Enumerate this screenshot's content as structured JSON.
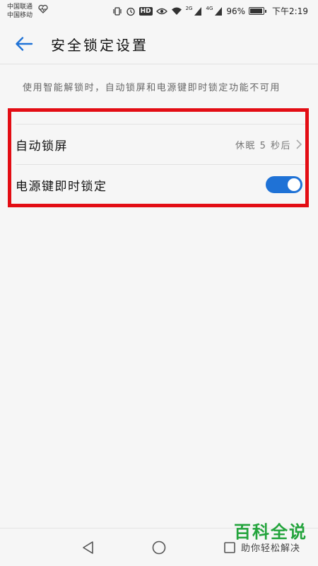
{
  "status_bar": {
    "carrier_1": "中国联通",
    "carrier_2": "中国移动",
    "battery_percent": "96%",
    "time": "下午2:19",
    "hd_label": "HD",
    "net_2g_label": "2G",
    "net_4g_label": "4G",
    "icons": [
      "pulse-icon",
      "vibrate-icon",
      "alarm-icon",
      "eye-icon",
      "wifi-icon",
      "signal-icon",
      "battery-icon"
    ]
  },
  "header": {
    "title": "安全锁定设置",
    "back_icon": "arrow-left-icon"
  },
  "hint": "使用智能解锁时，自动锁屏和电源键即时锁定功能不可用",
  "settings": {
    "auto_lock": {
      "label": "自动锁屏",
      "value": "休眠 5 秒后"
    },
    "power_key_lock": {
      "label": "电源键即时锁定",
      "enabled": true
    }
  },
  "colors": {
    "accent": "#1f72d6",
    "highlight_border": "#e30d14",
    "watermark_green": "#23a43c"
  },
  "navbar": {
    "icons": [
      "back-triangle-icon",
      "home-circle-icon",
      "recents-square-icon"
    ]
  },
  "watermark": {
    "main": "百科全说",
    "sub": "助你轻松解决"
  }
}
